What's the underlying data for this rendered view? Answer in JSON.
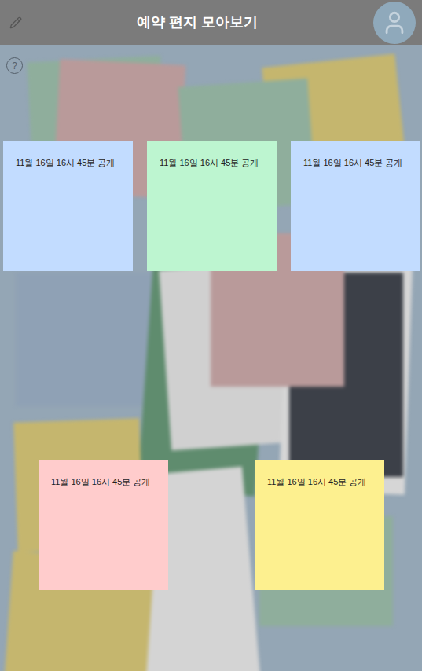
{
  "header": {
    "title": "예약 편지 모아보기"
  },
  "help": "?",
  "letters": [
    {
      "text": "11월 16일 16시 45분 공개",
      "color": "#c2dcff"
    },
    {
      "text": "11월 16일 16시 45분 공개",
      "color": "#bdf5d0"
    },
    {
      "text": "11월 16일 16시 45분 공개",
      "color": "#c2dcff"
    },
    {
      "text": "11월 16일 16시 45분 공개",
      "color": "#ffcccc"
    },
    {
      "text": "11월 16일 16시 45분 공개",
      "color": "#fdf08f"
    }
  ]
}
